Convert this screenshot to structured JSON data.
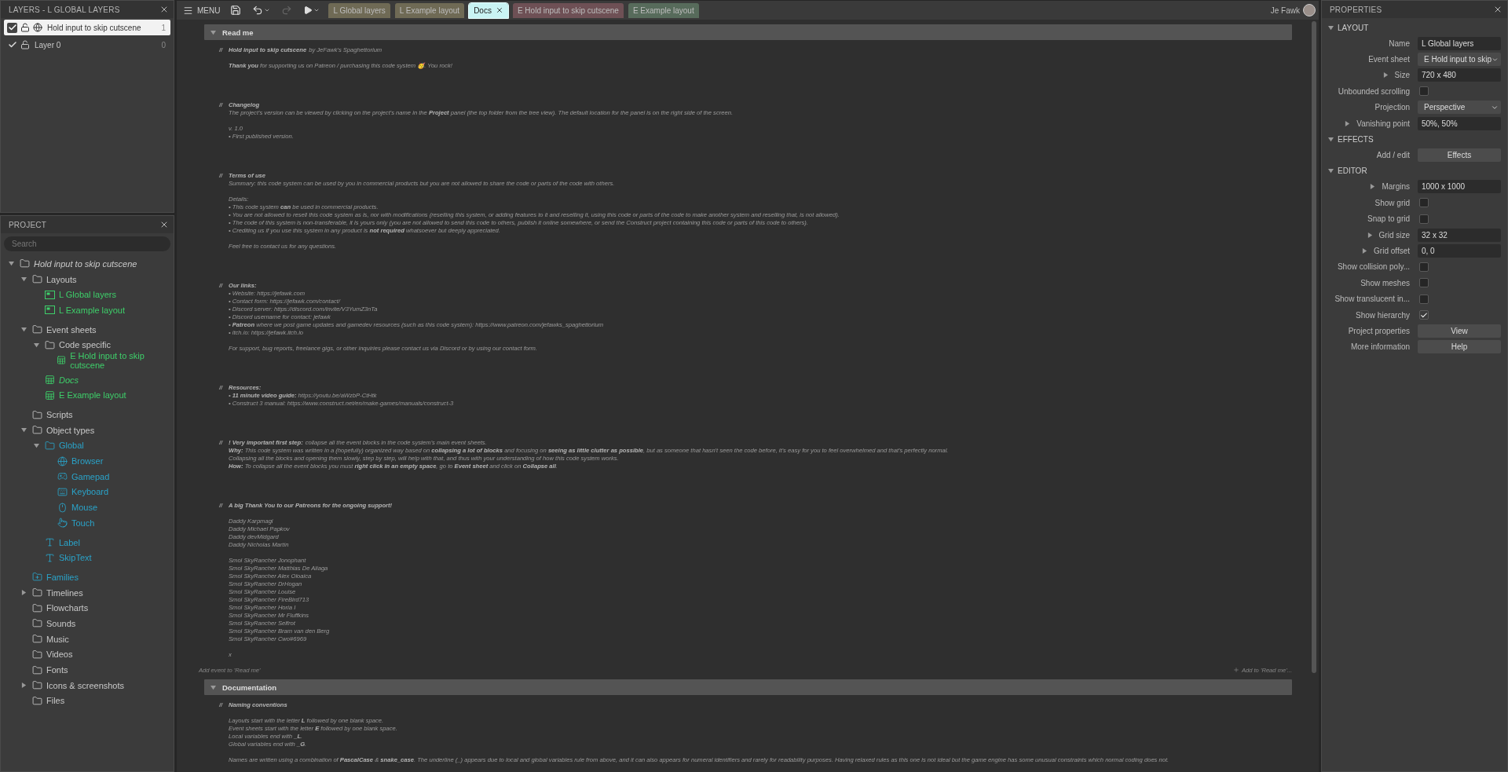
{
  "layers_panel": {
    "title": "LAYERS - L GLOBAL LAYERS",
    "layers": [
      {
        "name": "Hold input to skip cutscene",
        "count": "1",
        "visible": true,
        "global": true,
        "selected": true
      },
      {
        "name": "Layer 0",
        "count": "0",
        "visible": true,
        "global": false,
        "selected": false
      }
    ]
  },
  "project_panel": {
    "title": "PROJECT",
    "search": {
      "placeholder": "Search"
    },
    "tree": [
      {
        "label": "Hold input to skip cutscene",
        "kind": "folder",
        "color": "#c8c8c8",
        "italic": true,
        "expanded": true,
        "children": [
          {
            "label": "Layouts",
            "kind": "folder",
            "color": "#c8c8c8",
            "expanded": true,
            "children": [
              {
                "label": "L Global layers",
                "kind": "layout",
                "color": "#3ecf6a"
              },
              {
                "label": "L Example layout",
                "kind": "layout",
                "color": "#3ecf6a"
              }
            ]
          },
          {
            "label": "Event sheets",
            "kind": "folder",
            "color": "#c8c8c8",
            "expanded": true,
            "children": [
              {
                "label": "Code specific",
                "kind": "folder",
                "color": "#c8c8c8",
                "expanded": true,
                "children": [
                  {
                    "label": "E Hold input to skip cutscene",
                    "kind": "eventsheet",
                    "color": "#3ecf6a"
                  }
                ]
              },
              {
                "label": "Docs",
                "kind": "eventsheet",
                "color": "#3ecf6a",
                "italic": true
              },
              {
                "label": "E Example layout",
                "kind": "eventsheet",
                "color": "#3ecf6a"
              }
            ]
          },
          {
            "label": "Scripts",
            "kind": "folder",
            "color": "#c8c8c8"
          },
          {
            "label": "Object types",
            "kind": "folder",
            "color": "#c8c8c8",
            "expanded": true,
            "children": [
              {
                "label": "Global",
                "kind": "folder",
                "color": "#2aa3c9",
                "expanded": true,
                "children": [
                  {
                    "label": "Browser",
                    "kind": "browser",
                    "color": "#2aa3c9"
                  },
                  {
                    "label": "Gamepad",
                    "kind": "gamepad",
                    "color": "#2aa3c9"
                  },
                  {
                    "label": "Keyboard",
                    "kind": "keyboard",
                    "color": "#2aa3c9"
                  },
                  {
                    "label": "Mouse",
                    "kind": "mouse",
                    "color": "#2aa3c9"
                  },
                  {
                    "label": "Touch",
                    "kind": "touch",
                    "color": "#2aa3c9"
                  }
                ]
              },
              {
                "label": "Label",
                "kind": "text",
                "color": "#2aa3c9"
              },
              {
                "label": "SkipText",
                "kind": "text",
                "color": "#2aa3c9"
              }
            ]
          },
          {
            "label": "Families",
            "kind": "family",
            "color": "#2aa3c9"
          },
          {
            "label": "Timelines",
            "kind": "folder",
            "color": "#c8c8c8",
            "expanded": false
          },
          {
            "label": "Flowcharts",
            "kind": "folder",
            "color": "#c8c8c8"
          },
          {
            "label": "Sounds",
            "kind": "folder",
            "color": "#c8c8c8"
          },
          {
            "label": "Music",
            "kind": "folder",
            "color": "#c8c8c8"
          },
          {
            "label": "Videos",
            "kind": "folder",
            "color": "#c8c8c8"
          },
          {
            "label": "Fonts",
            "kind": "folder",
            "color": "#c8c8c8"
          },
          {
            "label": "Icons & screenshots",
            "kind": "folder",
            "color": "#c8c8c8",
            "expanded": false
          },
          {
            "label": "Files",
            "kind": "folder",
            "color": "#c8c8c8"
          }
        ]
      }
    ]
  },
  "toolbar": {
    "menu": "MENU",
    "buttons": [
      {
        "kind": "save",
        "disabled": false
      },
      {
        "kind": "undo",
        "disabled": false
      },
      {
        "kind": "redo",
        "disabled": true
      },
      {
        "kind": "play",
        "disabled": false
      }
    ],
    "tabs": [
      {
        "label": "L Global layers",
        "color": "#6f6a55",
        "selected": false
      },
      {
        "label": "L Example layout",
        "color": "#6f6a55",
        "selected": false
      },
      {
        "label": "Docs",
        "color": "#c9f3f3",
        "selected": true
      },
      {
        "label": "E Hold input to skip cutscene",
        "color": "#6e5055",
        "selected": false
      },
      {
        "label": "E Example layout",
        "color": "#576b5b",
        "selected": false
      }
    ],
    "user": "Je Fawk"
  },
  "event_sheet": {
    "groups": [
      {
        "title": "Read me",
        "expanded": true,
        "add_event": "Add event to 'Read me'",
        "add_action": "Add to 'Read me'...",
        "comments": [
          {
            "marker": "//",
            "title": "Hold input to skip cutscene",
            "title_rest": "by JeFawk's Spaghettorium",
            "title_gap": true,
            "paragraphs": [
              [
                "**Thank you** for supporting us on Patreon / purchasing this code system 🥳. You rock!"
              ]
            ]
          },
          {
            "marker": "//",
            "title": "Changelog",
            "paragraphs": [
              [
                "The project's version can be viewed by clicking on the project's name in the **Project** panel (the top folder from the tree view). The default location for the panel is on the right side of the screen."
              ],
              [
                "v. 1.0",
                "• First published version."
              ]
            ]
          },
          {
            "marker": "//",
            "title": "Terms of use",
            "paragraphs": [
              [
                "Summary: this code system can be used by you in commercial products but you are not allowed to share the code or parts of the code with others."
              ],
              [
                "Details:",
                "• This code system **can** be used in commercial products.",
                "• You are not allowed to resell this code system as is, nor with modifications (reselling this system, or adding features to it and reselling it, using this code or parts of the code to make another system and reselling that, is not allowed).",
                "• The code of this system is non-transferable, it is yours only (you are not allowed to send this code to others, publish it online somewhere, or send the Construct project containing this code or parts of this code to others).",
                "• Crediting us if you use this system in any product is **not required** whatsoever but deeply appreciated."
              ],
              [
                "Feel free to contact us for any questions."
              ]
            ]
          },
          {
            "marker": "//",
            "title": "Our links:",
            "paragraphs": [
              [
                "• Website: https://jefawk.com",
                "• Contact form: https://jefawk.com/contact/",
                "• Discord server: https://discord.com/invite/V3YumZ3nTa",
                "• Discord username for contact: jefawk",
                "• **Patreon** where we post game updates and gamedev resources (such as this code system): https://www.patreon.com/jefawks_spaghettorium",
                "• itch.io: https://jefawk.itch.io"
              ],
              [
                "For support, bug reports, freelance gigs, or other inquiries please contact us via Discord or by using our contact form."
              ]
            ]
          },
          {
            "marker": "//",
            "title": "Resources:",
            "paragraphs": [
              [
                "• **11 minute video guide:** https://youtu.be/aWzbP-CtHtk",
                "• Construct 3 manual: https://www.construct.net/en/make-games/manuals/construct-3"
              ]
            ]
          },
          {
            "marker": "//",
            "title": "! Very important first step:",
            "title_rest": "collapse all the event blocks in the code system's main event sheets.",
            "paragraphs": [
              [
                "**Why:** This code system was written in a (hopefully) organized way based on **collapsing a lot of blocks** and focusing on **seeing as little clutter as possible**, but as someone that hasn't seen the code before, it's easy for you to feel overwhelmed and that's perfectly normal.",
                "Collapsing all the blocks and opening them slowly, step by step, will help with that, and thus with your understanding of how this code system works.",
                "**How:** To collapse all the event blocks you must **right click in an empty space**, go to **Event sheet** and click on **Collapse all**."
              ]
            ]
          },
          {
            "marker": "//",
            "title": "A big Thank You to our Patreons for the ongoing support!",
            "title_gap": true,
            "paragraphs": [
              [
                "Daddy Karpmagi",
                "Daddy Michael Papkov",
                "Daddy devMidgard",
                "Daddy Nicholas Martin"
              ],
              [
                "Smol SkyRancher Jonophant",
                "Smol SkyRancher Matthias De Aliaga",
                "Smol SkyRancher Alex Oloaica",
                "Smol SkyRancher DrHogan",
                "Smol SkyRancher Louise",
                "Smol SkyRancher FireBird713",
                "Smol SkyRancher Horia I",
                "Smol SkyRancher Mr Fluffkins",
                "Smol SkyRancher Selfrot",
                "Smol SkyRancher Bram van den Berg",
                "Smol SkyRancher Cwo#6969"
              ],
              [
                "x"
              ]
            ]
          }
        ]
      },
      {
        "title": "Documentation",
        "expanded": true,
        "comments": [
          {
            "marker": "//",
            "title": "Naming conventions",
            "title_gap": true,
            "paragraphs": [
              [
                "Layouts start with the letter **L** followed by one blank space.",
                "Event sheets start with the letter **E** followed by one blank space.",
                "Local variables end with **_L**.",
                "Global variables end with **_G**."
              ],
              [
                "Names are written using a combination of **PascalCase** & **snake_case**. The underline (_) appears due to local and global variables rule from above, and it can also appears for numeral identifiers and rarely for readability purposes. Having relaxed rules as this one is not ideal but the game engine has some unusual constraints which normal coding does not."
              ]
            ]
          }
        ]
      }
    ]
  },
  "properties_panel": {
    "title": "PROPERTIES",
    "sections": [
      {
        "title": "LAYOUT",
        "expanded": true,
        "rows": [
          {
            "label": "Name",
            "kind": "text",
            "value": "L Global layers"
          },
          {
            "label": "Event sheet",
            "kind": "dropdown",
            "value": "E Hold input to skip"
          },
          {
            "label": "Size",
            "kind": "text",
            "value": "720 x 480",
            "expanded": false
          },
          {
            "label": "Unbounded scrolling",
            "kind": "checkbox",
            "checked": false
          },
          {
            "label": "Projection",
            "kind": "dropdown",
            "value": "Perspective"
          },
          {
            "label": "Vanishing point",
            "kind": "text",
            "value": "50%, 50%",
            "expanded": false
          }
        ]
      },
      {
        "title": "EFFECTS",
        "expanded": true,
        "rows": [
          {
            "label": "Add / edit",
            "kind": "button",
            "value": "Effects"
          }
        ]
      },
      {
        "title": "EDITOR",
        "expanded": true,
        "rows": [
          {
            "label": "Margins",
            "kind": "text",
            "value": "1000 x 1000",
            "expanded": false
          },
          {
            "label": "Show grid",
            "kind": "checkbox",
            "checked": false
          },
          {
            "label": "Snap to grid",
            "kind": "checkbox",
            "checked": false
          },
          {
            "label": "Grid size",
            "kind": "text",
            "value": "32 x 32",
            "expanded": false
          },
          {
            "label": "Grid offset",
            "kind": "text",
            "value": "0, 0",
            "expanded": false
          },
          {
            "label": "Show collision poly...",
            "kind": "checkbox",
            "checked": false
          },
          {
            "label": "Show meshes",
            "kind": "checkbox",
            "checked": false
          },
          {
            "label": "Show translucent in...",
            "kind": "checkbox",
            "checked": false
          },
          {
            "label": "Show hierarchy",
            "kind": "checkbox",
            "checked": true
          },
          {
            "label": "Project properties",
            "kind": "button",
            "value": "View"
          },
          {
            "label": "More information",
            "kind": "button",
            "value": "Help"
          }
        ]
      }
    ]
  }
}
